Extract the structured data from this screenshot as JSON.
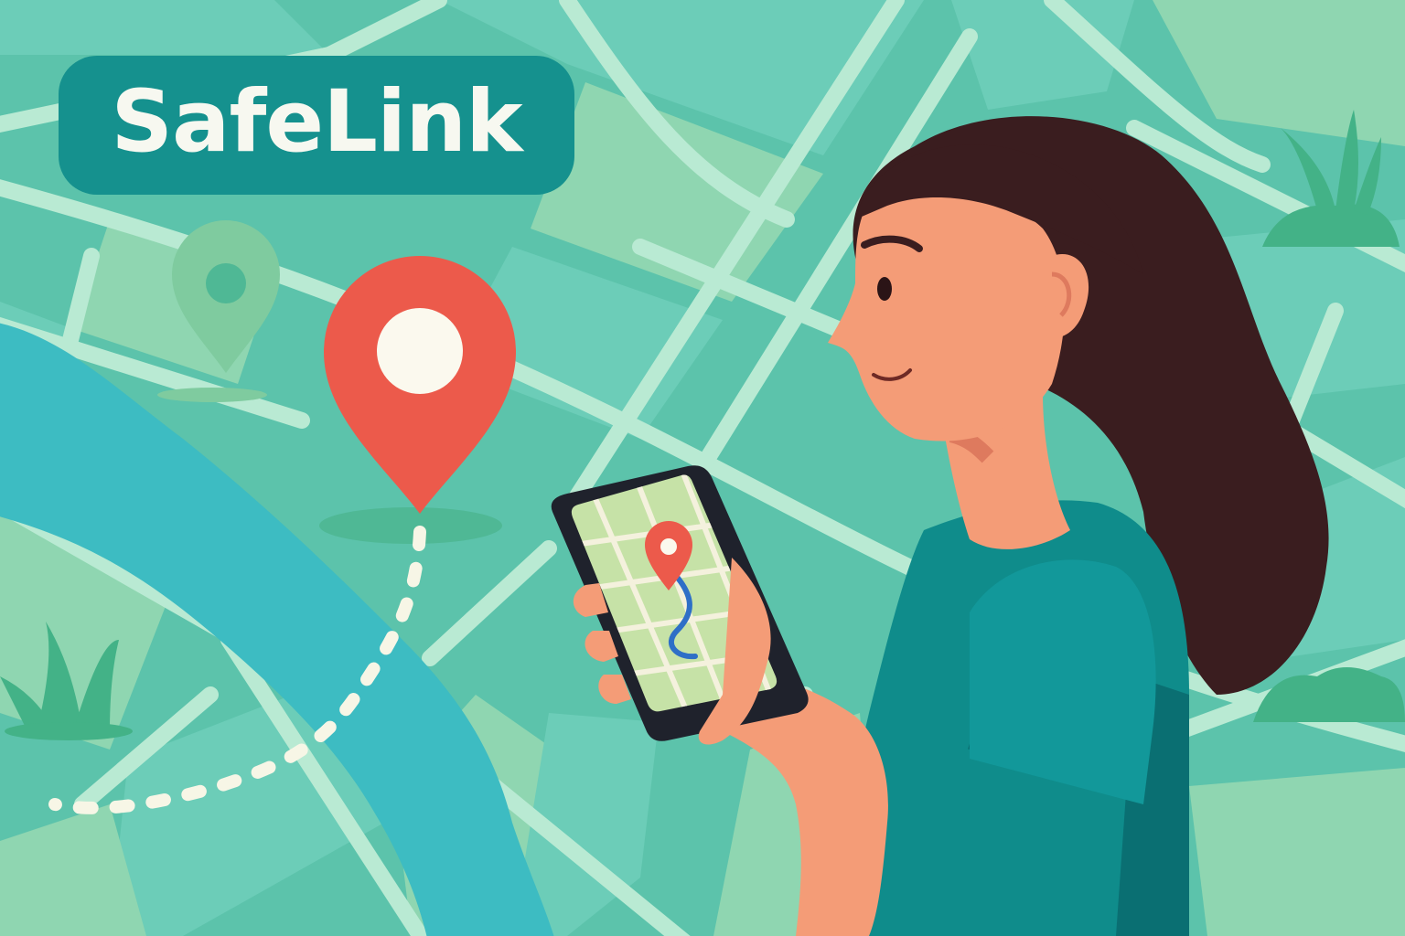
{
  "app": {
    "brand_name": "SafeLink"
  },
  "colors": {
    "map_base": "#5cc3ab",
    "block_light": "#8fd6b1",
    "block_teal": "#6ccdb8",
    "road": "#b9ead3",
    "river": "#3dbcc2",
    "badge_bg": "#15918e",
    "badge_text": "#f7f8f0",
    "pin_red": "#ec5a4b",
    "pin_faded": "#7fcb9f",
    "route_dots": "#f7f6e6",
    "phone_frame": "#1f222c",
    "screen_map": "#c6e2a7",
    "route_blue": "#2e6fc7",
    "hair": "#3a1d1f",
    "skin": "#f49c77",
    "shirt": "#0f8c8b",
    "plants": "#43b287"
  },
  "icons": {
    "main_marker": "map-pin-icon",
    "faded_marker": "map-pin-icon",
    "phone_marker": "map-pin-icon"
  }
}
